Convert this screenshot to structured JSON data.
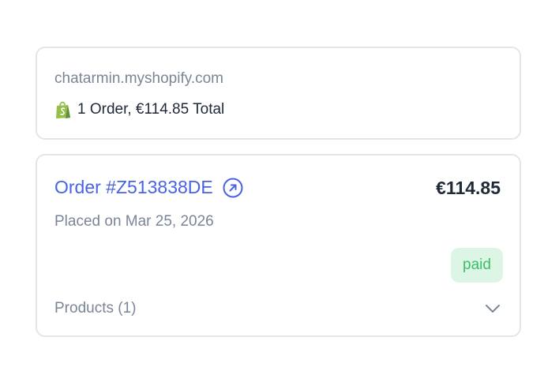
{
  "store": {
    "domain": "chatarmin.myshopify.com",
    "summary": "1 Order, €114.85 Total",
    "icon": "shopify-bag-icon",
    "icon_color": "#95bf47"
  },
  "order": {
    "title": "Order #Z513838DE",
    "total": "€114.85",
    "placed_on": "Placed on Mar 25, 2026",
    "status": "paid",
    "products_label": "Products (1)",
    "link_icon": "external-link-icon",
    "expand_icon": "chevron-down-icon"
  },
  "colors": {
    "link": "#4763e4",
    "muted": "#7a8595",
    "status_bg": "#dcf5e4",
    "status_text": "#3bbf67",
    "border": "#e3e5e8"
  }
}
